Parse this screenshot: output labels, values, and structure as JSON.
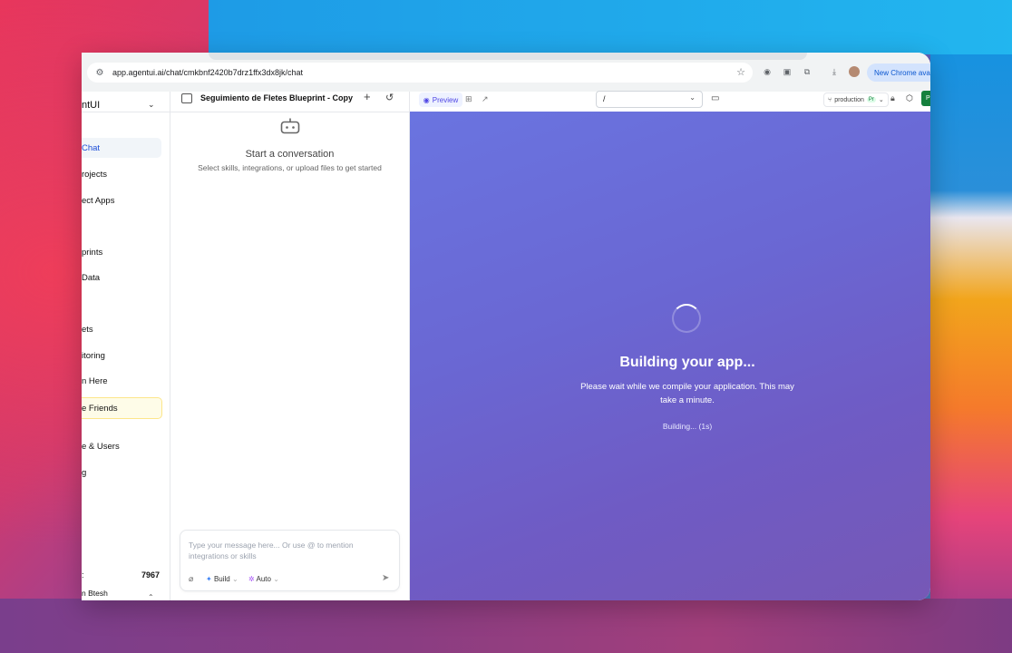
{
  "browser": {
    "url": "app.agentui.ai/chat/cmkbnf2420b7drz1ffx3dx8jk/chat",
    "new_chrome_label": "New Chrome avai"
  },
  "header": {
    "workspace_name": "ntUI",
    "project_title": "Seguimiento de Fletes Blueprint - Copy",
    "preview_tab": "Preview",
    "route_value": "/",
    "environment": "production",
    "env_pill": "Pr",
    "publish_label": "P"
  },
  "sidebar": {
    "items": [
      {
        "label": "Chat"
      },
      {
        "label": "rojects"
      },
      {
        "label": "ect Apps"
      },
      {
        "label": "prints"
      },
      {
        "label": "Data"
      },
      {
        "label": "ets"
      },
      {
        "label": "itoring"
      },
      {
        "label": "n Here"
      },
      {
        "label": "e Friends"
      },
      {
        "label": "e & Users"
      },
      {
        "label": "g"
      }
    ],
    "credits_value": "7967",
    "user_name": "n Btesh"
  },
  "chat": {
    "empty_title": "Start a conversation",
    "empty_subtitle": "Select skills, integrations, or upload files to get started",
    "composer_placeholder": "Type your message here... Or use @ to mention integrations or skills",
    "mode_build": "Build",
    "mode_auto": "Auto"
  },
  "preview": {
    "title": "Building your app...",
    "subtitle": "Please wait while we compile your application. This may take a minute.",
    "status": "Building... (1s)"
  }
}
